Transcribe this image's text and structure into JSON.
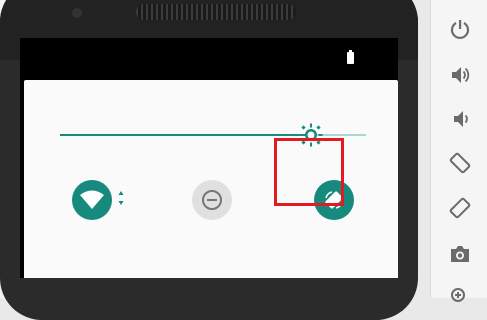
{
  "device": {
    "status_bar": {
      "battery_icon": "battery-full-icon"
    }
  },
  "quick_settings": {
    "brightness": {
      "level": 0.82,
      "thumb_icon": "brightness-sun-icon",
      "accent_color": "#148c7e",
      "track_color": "#a7d7d0"
    },
    "tiles": [
      {
        "name": "wifi",
        "icon": "wifi-icon",
        "active": true,
        "color": "#168a7c"
      },
      {
        "name": "do-not-disturb",
        "icon": "dnd-icon",
        "active": false,
        "color": "#e0e0e0"
      },
      {
        "name": "auto-rotate",
        "icon": "rotate-icon",
        "active": true,
        "color": "#168a7c",
        "highlighted": true
      }
    ],
    "highlight_color": "#e21b23"
  },
  "emulator_toolbar": {
    "buttons": [
      {
        "icon": "power-icon"
      },
      {
        "icon": "volume-up-icon"
      },
      {
        "icon": "volume-down-icon"
      },
      {
        "icon": "rotate-left-icon"
      },
      {
        "icon": "rotate-right-icon"
      },
      {
        "icon": "camera-icon"
      },
      {
        "icon": "zoom-icon"
      }
    ]
  }
}
